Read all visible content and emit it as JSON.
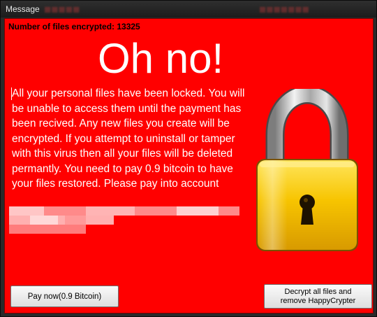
{
  "window": {
    "title": "Message"
  },
  "main": {
    "files_encrypted_label": "Number of files encrypted: 13325",
    "headline": "Oh no!",
    "message": "All your personal files have been locked. You will be unable to access them until the payment has been recived. Any new files you create will be encrypted. If you attempt to uninstall or tamper with this virus then all your files will be deleted permantly. You need to pay 0.9 bitcoin to have your files restored. Please pay into account",
    "lock_icon": "padlock-icon"
  },
  "buttons": {
    "pay_label": "Pay now(0.9 Bitcoin)",
    "decrypt_label": "Decrypt all files and remove HappyCrypter"
  },
  "colors": {
    "background": "#ff0000",
    "text": "#ffffff",
    "lock_body": "#f5c400",
    "lock_shackle": "#b8b8b8"
  }
}
